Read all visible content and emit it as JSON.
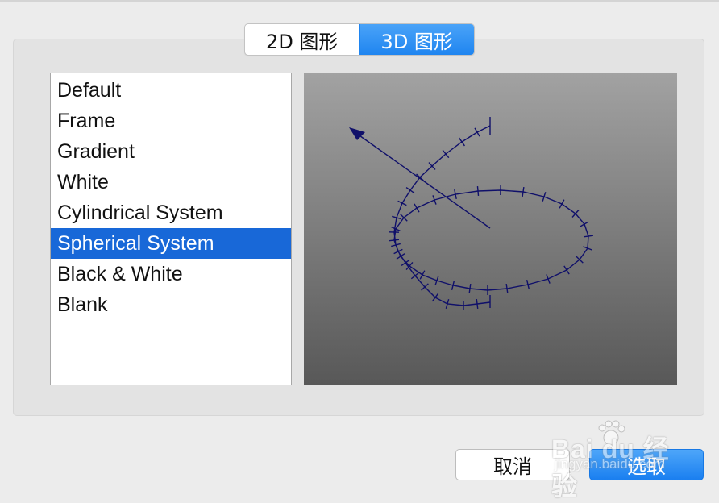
{
  "tabs": [
    {
      "label": "2D 图形",
      "active": false
    },
    {
      "label": "3D 图形",
      "active": true
    }
  ],
  "styles": {
    "items": [
      "Default",
      "Frame",
      "Gradient",
      "White",
      "Cylindrical System",
      "Spherical System",
      "Black & White",
      "Blank"
    ],
    "selected_index": 5
  },
  "buttons": {
    "cancel": "取消",
    "select": "选取"
  },
  "watermark": {
    "brand": "Bai du 经验",
    "url": "jingyan.baidu.com"
  },
  "colors": {
    "accent": "#1f85f0",
    "selection": "#1868d8",
    "curve": "#10106a"
  }
}
